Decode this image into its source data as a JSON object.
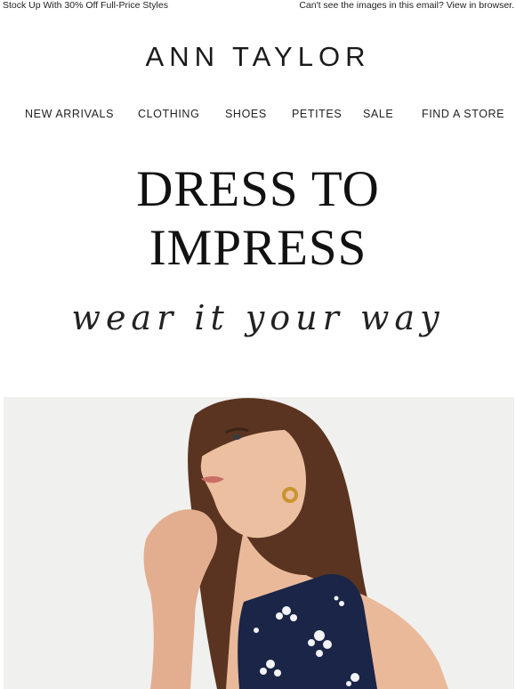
{
  "preheader": {
    "promo_text": "Stock Up With 30% Off Full-Price Styles",
    "view_in_browser_text": "Can't see the images in this email? View in browser."
  },
  "brand": {
    "logo_text": "ANN TAYLOR"
  },
  "nav": {
    "items": [
      {
        "label": "NEW ARRIVALS"
      },
      {
        "label": "CLOTHING"
      },
      {
        "label": "SHOES"
      },
      {
        "label": "PETITES"
      },
      {
        "label": "SALE"
      },
      {
        "label": "FIND A STORE"
      }
    ]
  },
  "hero": {
    "headline_line1": "DRESS TO",
    "headline_line2": "IMPRESS",
    "tagline": "wear it your way"
  },
  "colors": {
    "background": "#ffffff",
    "text": "#111111",
    "photo_background": "#f0f0ee",
    "hair": "#5a3420",
    "skin": "#e9b99a",
    "dress": "#1a2547",
    "embroidery": "#ffffff"
  }
}
